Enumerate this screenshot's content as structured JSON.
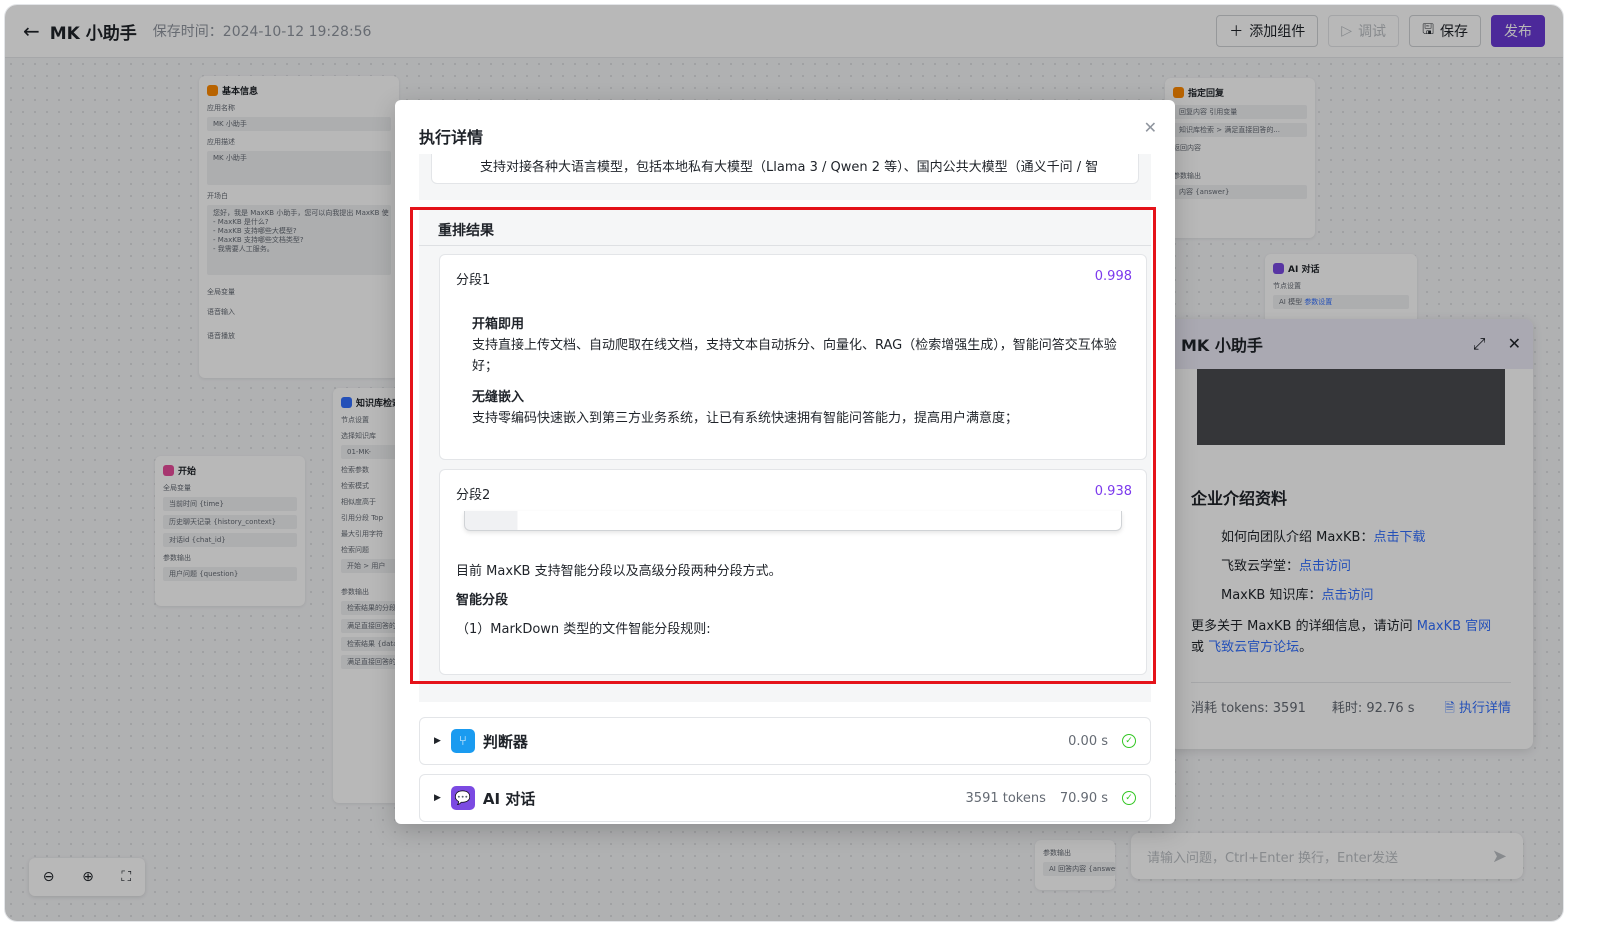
{
  "topbar": {
    "back_icon": "←",
    "title": "MK 小助手",
    "save_time": "保存时间：2024-10-12 19:28:56",
    "add_component": "添加组件",
    "debug": "调试",
    "save": "保存",
    "publish": "发布"
  },
  "bg_cards": {
    "basic_info": {
      "title": "基本信息",
      "app_name_label": "应用名称",
      "app_name": "MK 小助手",
      "app_desc_label": "应用描述",
      "app_desc": "MK 小助手",
      "opening_label": "开场白",
      "opening_lines": [
        "您好，我是 MaxKB 小助手，您可以向我提出 MaxKB 使",
        "- MaxKB 是什么?",
        "- MaxKB 支持哪些大模型?",
        "- MaxKB 支持哪些文档类型?",
        "- 我需要人工服务。"
      ],
      "global_var": "全局变量",
      "voice_input": "语音输入",
      "voice_play": "语音播放"
    },
    "start": {
      "title": "开始",
      "global_var": "全局变量",
      "rows": [
        "当前时间 {time}",
        "历史聊天记录 {history_context}",
        "对话id {chat_id}"
      ],
      "params_out": "参数输出",
      "question": "用户问题 {question}"
    },
    "kb_search": {
      "title": "知识库检索",
      "node_settings": "节点设置",
      "rows": [
        "选择知识库",
        "01-MK-",
        "检索参数",
        "检索模式",
        "相似度高于",
        "引用分段 Top",
        "最大引用字符",
        "检索问题",
        "开始 > 用户"
      ],
      "params_out": "参数输出",
      "outs": [
        "检索结果的分段 {paragraph_list",
        "满足直接回答的 {is_hit_handlin",
        "检索结果 {data",
        "满足直接回答的 {directly_retur"
      ]
    },
    "reply": {
      "title": "指定回复",
      "rows": [
        "回复内容  引用变量",
        "知识库检索 > 满足直接回答的..."
      ],
      "return_label": "返回内容",
      "params_out": "参数输出",
      "out": "内容 {answer}"
    },
    "ai_chat": {
      "title": "AI 对话",
      "node_settings": "节点设置",
      "model_label": "AI 模型",
      "model_link": "参数设置"
    },
    "bottom_out": {
      "params_out": "参数输出",
      "out": "AI 回答内容 {answer"
    }
  },
  "chat_panel": {
    "title": "MK 小助手",
    "heading": "企业介绍资料",
    "items": [
      {
        "label": "如何向团队介绍 MaxKB：",
        "link": "点击下载"
      },
      {
        "label": "飞致云学堂：",
        "link": "点击访问"
      },
      {
        "label": "MaxKB 知识库：",
        "link": "点击访问"
      }
    ],
    "more_prefix": "更多关于 MaxKB 的详细信息，请访问 ",
    "more_link1": "MaxKB 官网",
    "more_mid": "或 ",
    "more_link2": "飞致云官方论坛",
    "more_suffix": "。",
    "tokens": "消耗 tokens: 3591",
    "elapsed": "耗时: 92.76 s",
    "detail_link": "执行详情",
    "input_placeholder": "请输入问题，Ctrl+Enter 换行，Enter发送"
  },
  "modal": {
    "title": "执行详情",
    "top_snippet": "支持对接各种大语言模型，包括本地私有大模型（Llama 3 / Qwen 2 等）、国内公共大模型（通义千问 / 智",
    "rerank_title": "重排结果",
    "segments": [
      {
        "label": "分段1",
        "score": "0.998",
        "h1": "开箱即用",
        "p1": "支持直接上传文档、自动爬取在线文档，支持文本自动拆分、向量化、RAG（检索增强生成），智能问答交互体验好；",
        "h2": "无缝嵌入",
        "p2": "支持零编码快速嵌入到第三方业务系统，让已有系统快速拥有智能问答能力，提高用户满意度；"
      },
      {
        "label": "分段2",
        "score": "0.938",
        "p1": "目前 MaxKB 支持智能分段以及高级分段两种分段方式。",
        "h1": "智能分段",
        "p2": "（1）MarkDown 类型的文件智能分段规则:"
      }
    ],
    "steps": [
      {
        "name": "判断器",
        "tokens": "",
        "time": "0.00 s",
        "color": "#1a9bf0"
      },
      {
        "name": "AI 对话",
        "tokens": "3591 tokens",
        "time": "70.90 s",
        "color": "#7b4ae2"
      }
    ]
  }
}
